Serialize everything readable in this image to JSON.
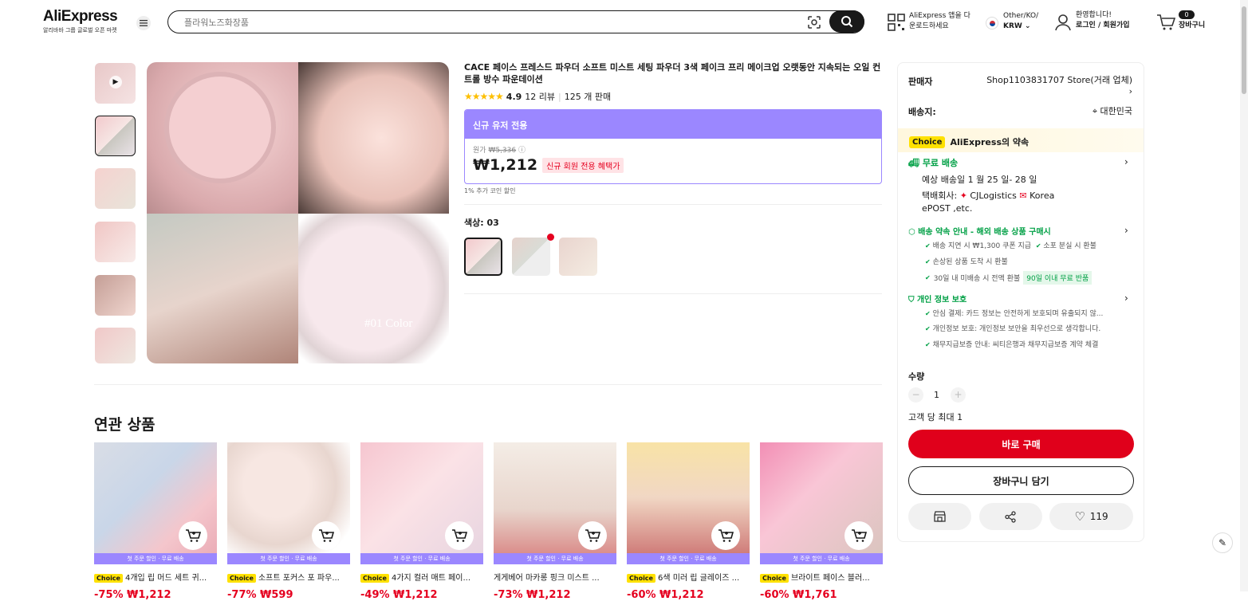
{
  "header": {
    "logo": "AliExpress",
    "logo_sub": "알리바바 그룹 글로벌 오픈 마켓",
    "search_placeholder": "플라워노즈화장품",
    "app_line1": "AliExpress 앱을 다",
    "app_line2": "운로드하세요",
    "region_line1": "Other/KO/",
    "region_line2": "KRW",
    "user_line1": "환영합니다!",
    "user_line2": "로그인 / 회원가입",
    "cart_count": "0",
    "cart_label": "장바구니"
  },
  "product": {
    "title": "CACE 페이스 프레스드 파우더 소프트 미스트 세팅 파우더 3색 페이크 프리 메이크업 오랫동안 지속되는 오일 컨트롤 방수 파운데이션",
    "rating": "4.9",
    "reviews": "12 리뷰",
    "sold": "125 개 판매",
    "promo_header": "신규 유저 전용",
    "original_label": "원가",
    "original_price": "₩5,336",
    "price": "₩1,212",
    "promo_badge": "신규 회원 전용 혜택가",
    "coin_note": "1% 추가 코인 할인",
    "color_label": "색상: 03",
    "main_image_text": "#01 Color"
  },
  "panel": {
    "seller_label": "판매자",
    "seller_name": "Shop1103831707 Store(거래 업체)",
    "ship_label": "배송지:",
    "ship_to": "대한민국",
    "choice_tag": "Choice",
    "choice_text": "AliExpress의 약속",
    "free_ship": "무료 배송",
    "delivery_est": "예상 배송일 1 월 25 일- 28 일",
    "carrier_label": "택배회사:",
    "carrier_1": "CJLogistics",
    "carrier_2": "Korea",
    "carrier_3": "ePOST ,etc.",
    "guarantee_title": "배송 약속 안내 - 해외 배송 상품 구매시",
    "g1": "배송 지연 시 ₩1,300 쿠폰 지급",
    "g2": "소포 분실 시 환불",
    "g3": "손상된 상품 도착 시 환불",
    "g4": "30일 내 미배송 시 전액 환불",
    "g4_badge": "90일 이내 무료 반품",
    "privacy_title": "개인 정보 보호",
    "p1": "안심 결제: 카드 정보는 안전하게 보호되며 유출되지 않...",
    "p2": "개인정보 보호: 개인정보 보안을 최우선으로 생각합니다.",
    "p3": "채무지급보증 안내: 씨티은행과 채무지급보증 계약 체결",
    "qty_label": "수량",
    "qty_value": "1",
    "qty_limit": "고객 당 최대 1",
    "buy_now": "바로 구매",
    "add_cart": "장바구니 담기",
    "wish_count": "119"
  },
  "related": {
    "title": "연관 상품",
    "strip_text": "첫 주문 할인 · 무료 배송",
    "items": [
      {
        "choice": "Choice",
        "title": "4개입 립 머드 세트 귀...",
        "price": "-75% ₩1,212"
      },
      {
        "choice": "Choice",
        "title": "소프트 포커스 포 파우...",
        "price": "-77% ₩599"
      },
      {
        "choice": "Choice",
        "title": "4가지 컬러 매트 페이...",
        "price": "-49% ₩1,212"
      },
      {
        "choice": "",
        "title": "게게베어 마카롱 핑크 미스트 ...",
        "price": "-73% ₩1,212"
      },
      {
        "choice": "Choice",
        "title": "6색 미러 립 글레이즈 ...",
        "price": "-60% ₩1,212"
      },
      {
        "choice": "Choice",
        "title": "브라이트 페이스 블러...",
        "price": "-60% ₩1,761"
      }
    ]
  },
  "colors": {
    "accent": "#e0001b",
    "promo": "#9b87ff",
    "choice": "#ffe100",
    "green": "#00a045"
  }
}
